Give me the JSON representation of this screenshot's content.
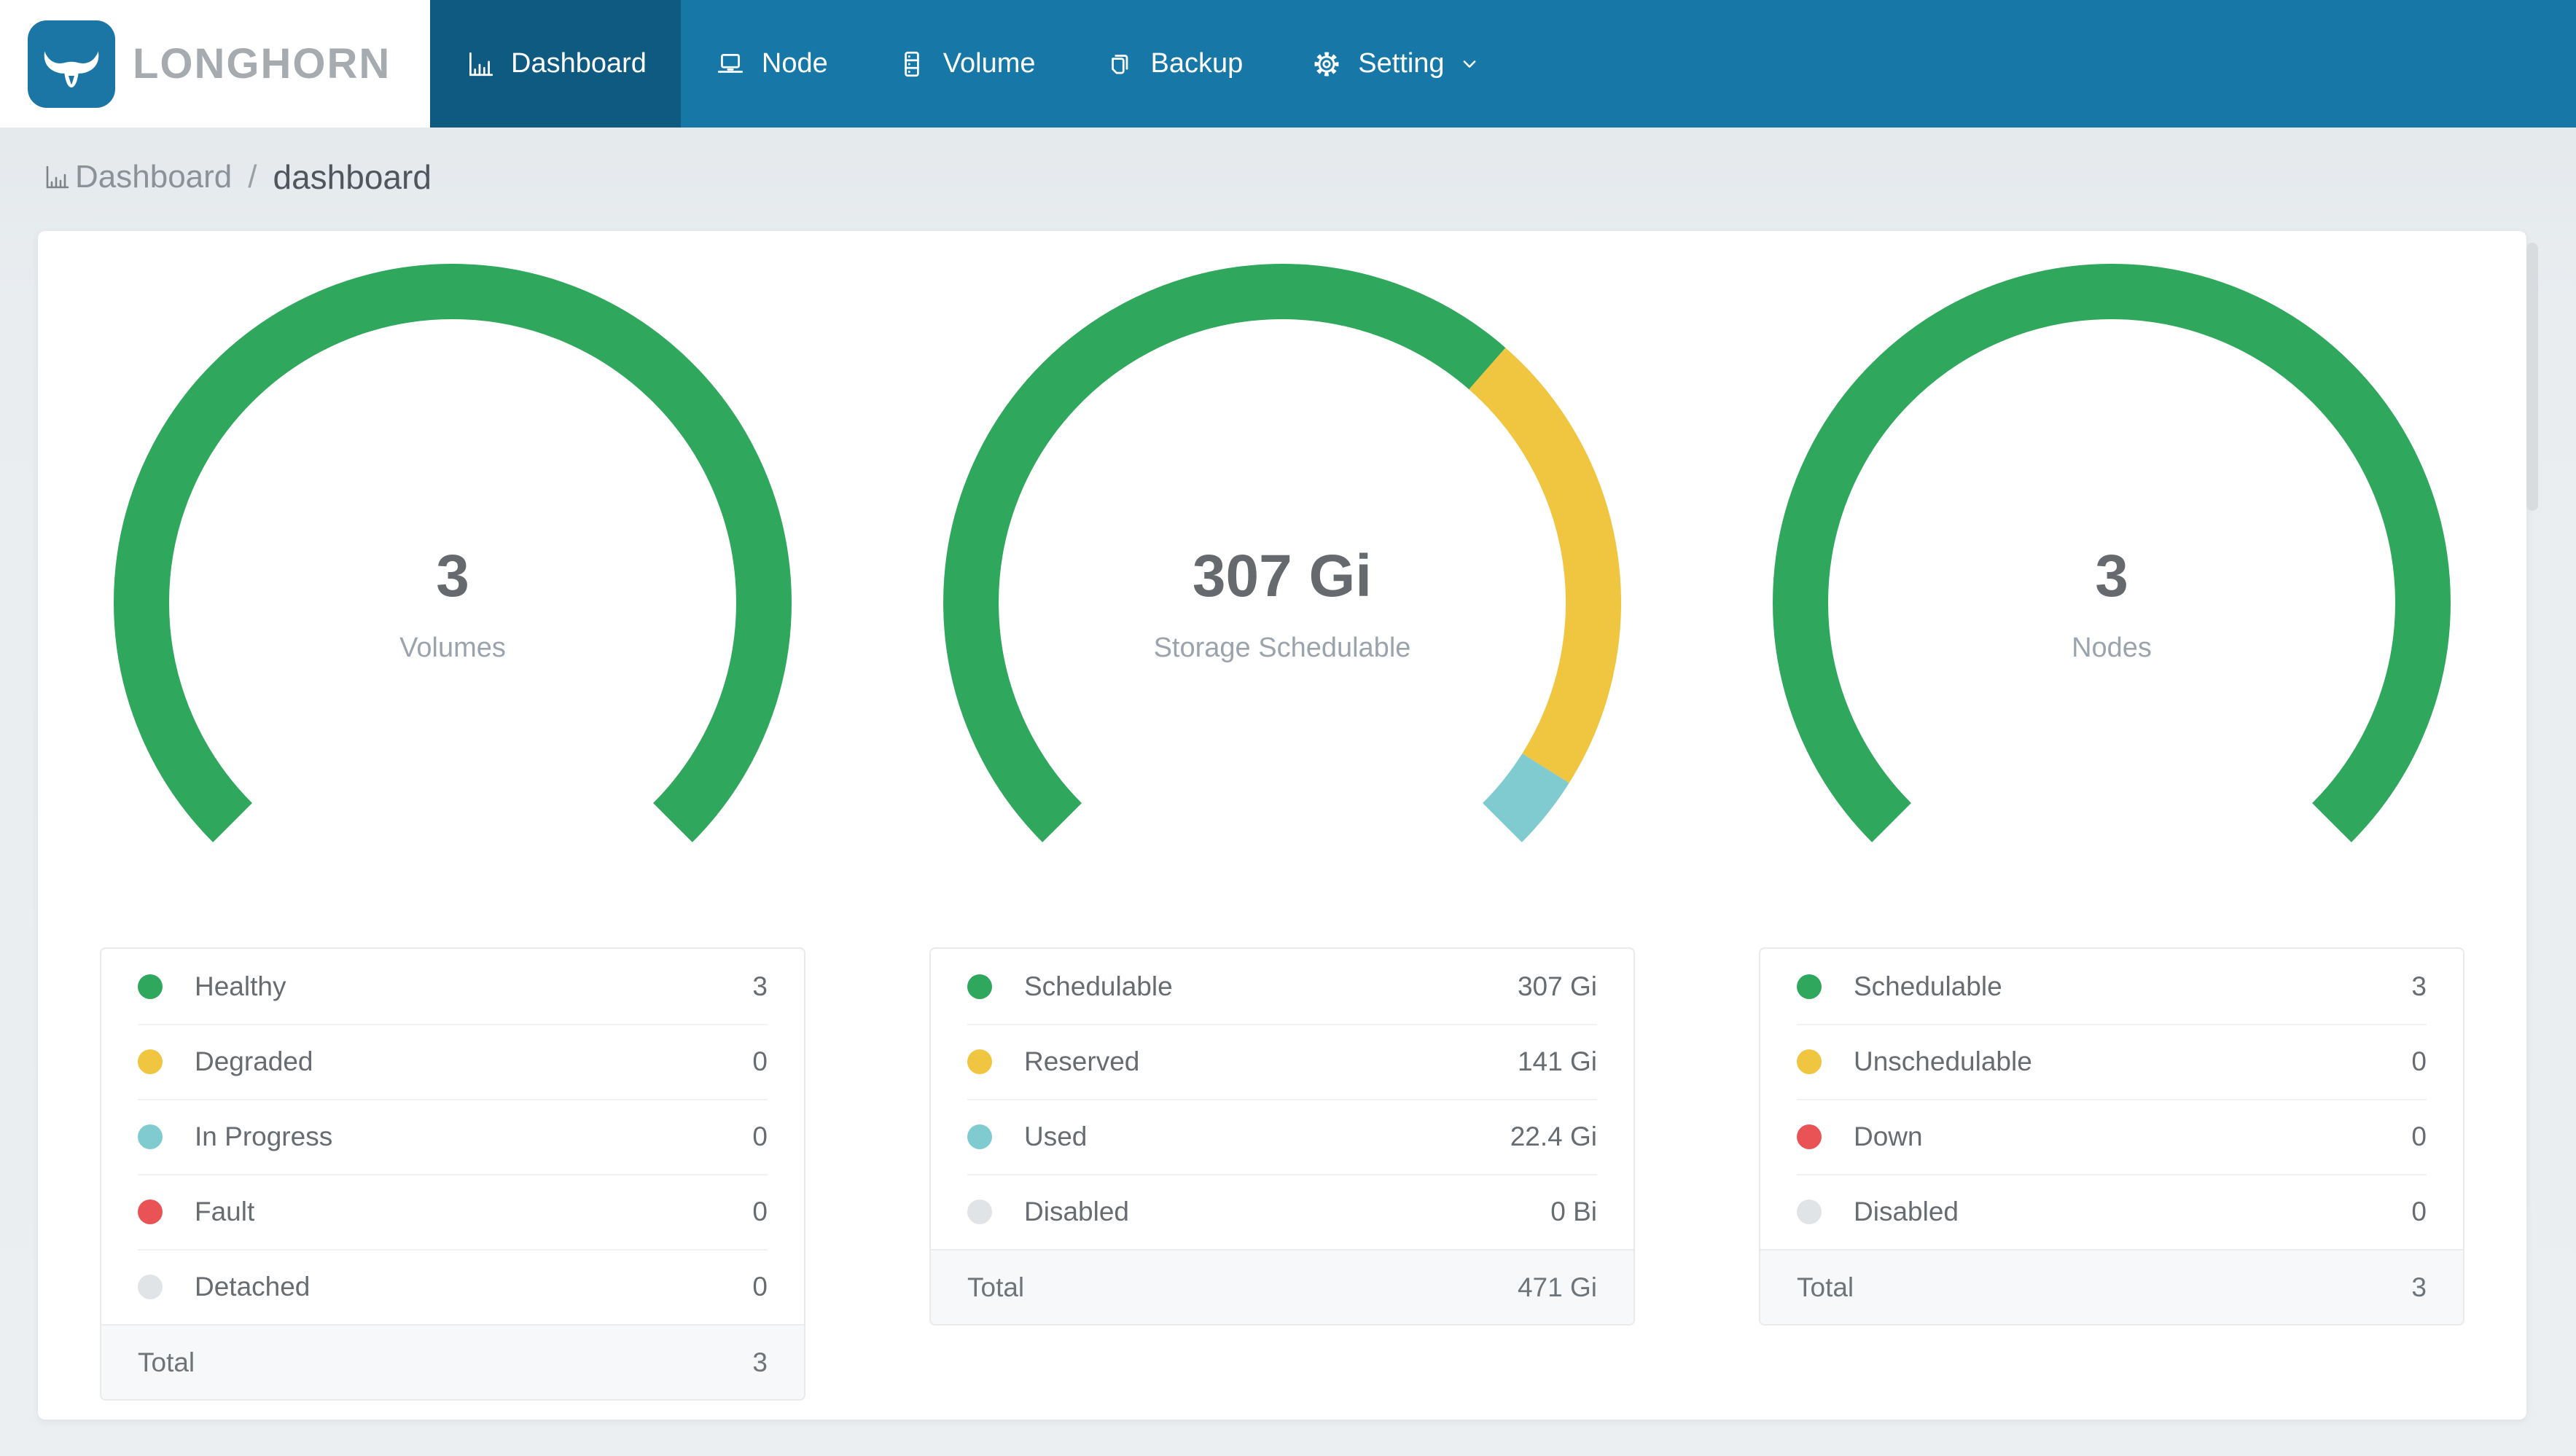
{
  "header": {
    "brand": "LONGHORN",
    "nav_items": [
      {
        "label": "Dashboard",
        "icon": "bar-chart",
        "active": true,
        "has_dropdown": false
      },
      {
        "label": "Node",
        "icon": "laptop",
        "active": false,
        "has_dropdown": false
      },
      {
        "label": "Volume",
        "icon": "server",
        "active": false,
        "has_dropdown": false
      },
      {
        "label": "Backup",
        "icon": "copy",
        "active": false,
        "has_dropdown": false
      },
      {
        "label": "Setting",
        "icon": "gear",
        "active": false,
        "has_dropdown": true
      }
    ]
  },
  "breadcrumb": {
    "icon": "bar-chart",
    "section": "Dashboard",
    "separator": "/",
    "page": "dashboard"
  },
  "colors": {
    "nav_bg": "#1778a8",
    "nav_active_bg": "#0f5a81",
    "logo_blue": "#1b76a6",
    "green": "#2fa75d",
    "yellow": "#f0c53f",
    "teal": "#7fcbd0",
    "red": "#ea5355",
    "disabled_gray": "#e1e4e7"
  },
  "chart_data": [
    {
      "type": "gauge",
      "title": "Volumes",
      "center_value": "3",
      "center_label": "Volumes",
      "start_deg": 225,
      "sweep_deg": 270,
      "rows": [
        {
          "label": "Healthy",
          "value": 3,
          "display": "3",
          "color": "#2fa75d"
        },
        {
          "label": "Degraded",
          "value": 0,
          "display": "0",
          "color": "#f0c53f"
        },
        {
          "label": "In Progress",
          "value": 0,
          "display": "0",
          "color": "#7fcbd0"
        },
        {
          "label": "Fault",
          "value": 0,
          "display": "0",
          "color": "#ea5355"
        },
        {
          "label": "Detached",
          "value": 0,
          "display": "0",
          "color": "#e1e4e7"
        }
      ],
      "total": {
        "label": "Total",
        "display": "3"
      }
    },
    {
      "type": "gauge",
      "title": "Storage Schedulable",
      "center_value": "307 Gi",
      "center_label": "Storage Schedulable",
      "start_deg": 225,
      "sweep_deg": 270,
      "rows": [
        {
          "label": "Schedulable",
          "value": 307,
          "display": "307 Gi",
          "color": "#2fa75d"
        },
        {
          "label": "Reserved",
          "value": 141,
          "display": "141 Gi",
          "color": "#f0c53f"
        },
        {
          "label": "Used",
          "value": 22.4,
          "display": "22.4 Gi",
          "color": "#7fcbd0"
        },
        {
          "label": "Disabled",
          "value": 0,
          "display": "0 Bi",
          "color": "#e1e4e7"
        }
      ],
      "total": {
        "label": "Total",
        "display": "471 Gi"
      }
    },
    {
      "type": "gauge",
      "title": "Nodes",
      "center_value": "3",
      "center_label": "Nodes",
      "start_deg": 225,
      "sweep_deg": 270,
      "rows": [
        {
          "label": "Schedulable",
          "value": 3,
          "display": "3",
          "color": "#2fa75d"
        },
        {
          "label": "Unschedulable",
          "value": 0,
          "display": "0",
          "color": "#f0c53f"
        },
        {
          "label": "Down",
          "value": 0,
          "display": "0",
          "color": "#ea5355"
        },
        {
          "label": "Disabled",
          "value": 0,
          "display": "0",
          "color": "#e1e4e7"
        }
      ],
      "total": {
        "label": "Total",
        "display": "3"
      }
    }
  ]
}
